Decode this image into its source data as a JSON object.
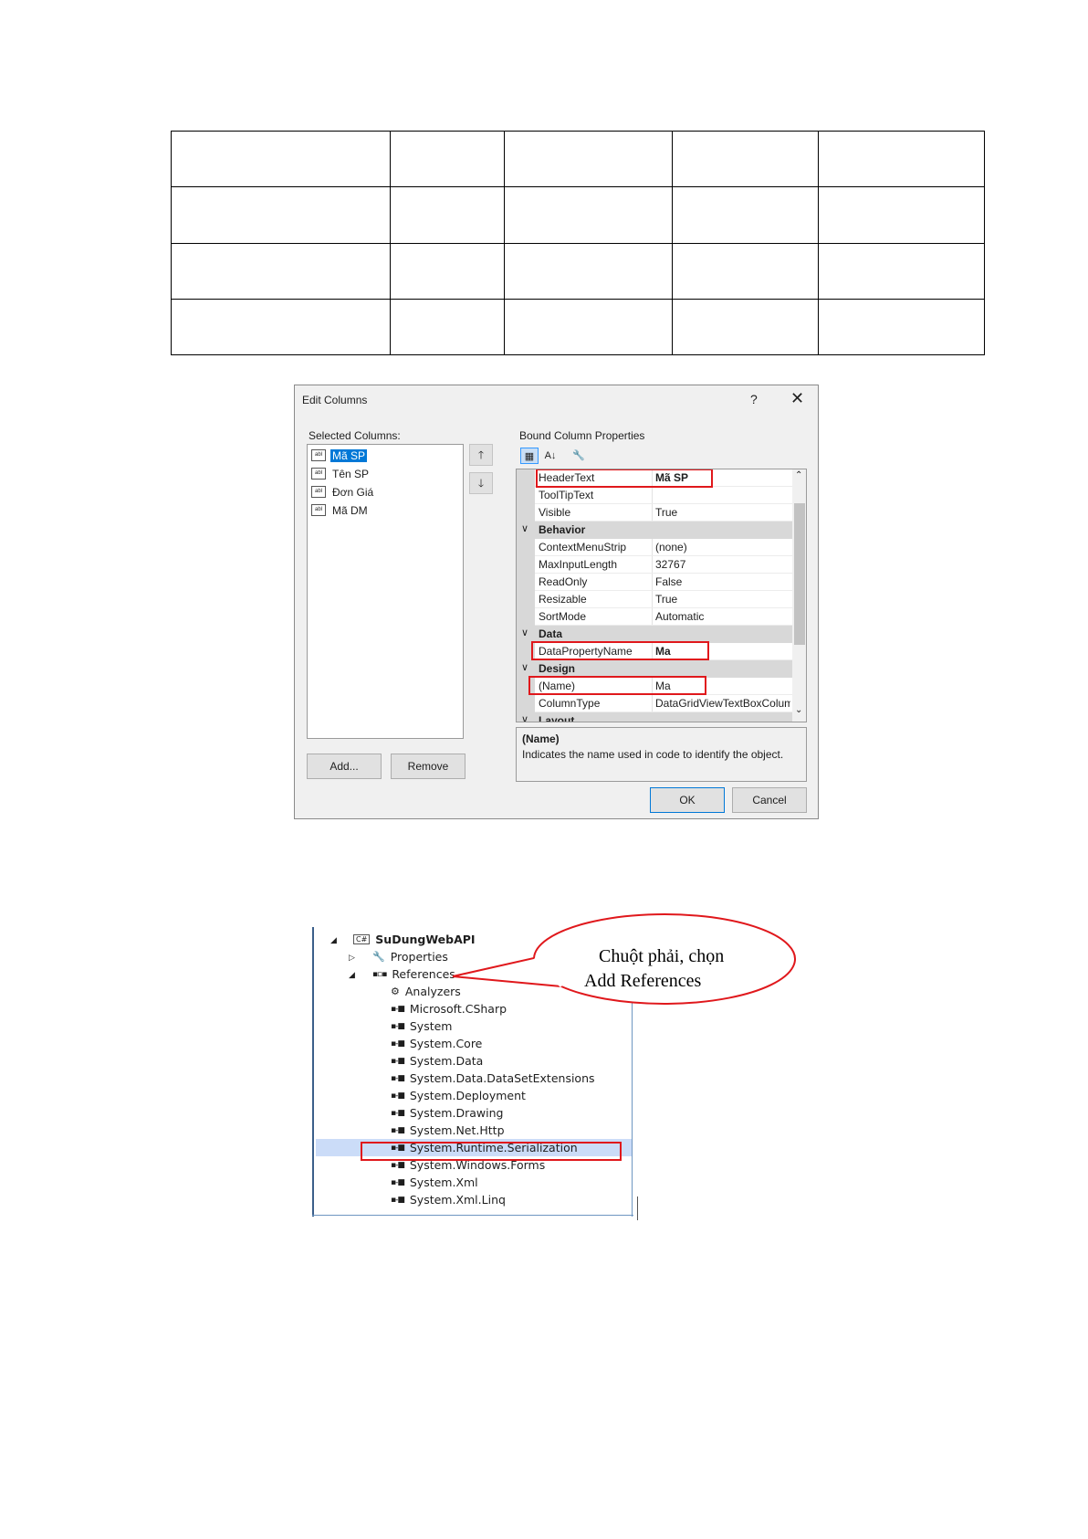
{
  "dialog": {
    "title": "Edit Columns",
    "help": "?",
    "close": "✕",
    "selected_columns_label": "Selected Columns:",
    "columns": [
      {
        "icon": "abl",
        "label": "Mã SP"
      },
      {
        "icon": "abl",
        "label": "Tên SP"
      },
      {
        "icon": "abl",
        "label": "Đơn Giá"
      },
      {
        "icon": "abl",
        "label": "Mã DM"
      }
    ],
    "move_up": "🡑",
    "move_down": "🡓",
    "add_button": "Add...",
    "remove_button": "Remove",
    "bound_label": "Bound Column Properties",
    "toolbar": {
      "categorized": "▦",
      "alphabetical": "A↓",
      "property_pages": "🔧"
    },
    "properties": {
      "header_text": {
        "name": "HeaderText",
        "value": "Mã SP"
      },
      "tooltip_text": {
        "name": "ToolTipText",
        "value": ""
      },
      "visible": {
        "name": "Visible",
        "value": "True"
      },
      "behavior": {
        "chev": "∨",
        "name": "Behavior"
      },
      "context_menu": {
        "name": "ContextMenuStrip",
        "value": "(none)"
      },
      "max_input": {
        "name": "MaxInputLength",
        "value": "32767"
      },
      "read_only": {
        "name": "ReadOnly",
        "value": "False"
      },
      "resizable": {
        "name": "Resizable",
        "value": "True"
      },
      "sort_mode": {
        "name": "SortMode",
        "value": "Automatic"
      },
      "data": {
        "chev": "∨",
        "name": "Data"
      },
      "data_property": {
        "name": "DataPropertyName",
        "value": "Ma"
      },
      "design": {
        "chev": "∨",
        "name": "Design"
      },
      "name_prop": {
        "name": "(Name)",
        "value": "Ma"
      },
      "column_type": {
        "name": "ColumnType",
        "value": "DataGridViewTextBoxColumn"
      },
      "layout": {
        "chev": "∨",
        "name": "Layout"
      }
    },
    "description": {
      "title": "(Name)",
      "text": "Indicates the name used in code to identify the object."
    },
    "ok_button": "OK",
    "cancel_button": "Cancel"
  },
  "solution": {
    "project": {
      "tri": "◢",
      "icon": "C#",
      "name": "SuDungWebAPI"
    },
    "properties": {
      "tri": "▷",
      "icon": "🔧",
      "name": "Properties"
    },
    "references": {
      "tri": "◢",
      "icon": "▪▫▪",
      "name": "References"
    },
    "analyzers": {
      "icon": "⚙",
      "name": "Analyzers"
    },
    "refs": [
      "Microsoft.CSharp",
      "System",
      "System.Core",
      "System.Data",
      "System.Data.DataSetExtensions",
      "System.Deployment",
      "System.Drawing",
      "System.Net.Http",
      "System.Runtime.Serialization",
      "System.Windows.Forms",
      "System.Xml",
      "System.Xml.Linq"
    ],
    "ref_icon": "▪-■",
    "callout": {
      "line1": "Chuột phải, chọn",
      "line2": "Add References"
    }
  }
}
